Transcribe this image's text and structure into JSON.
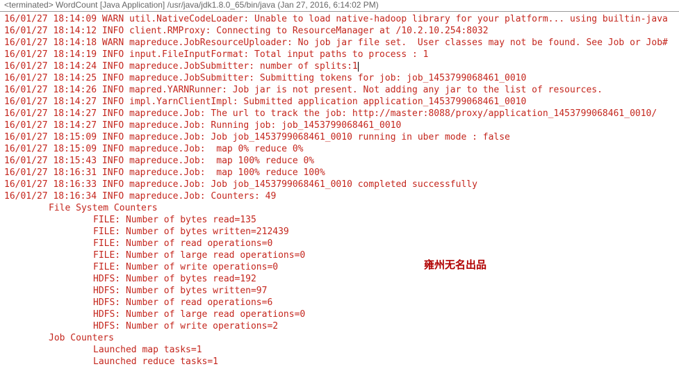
{
  "header": {
    "text": "<terminated> WordCount [Java Application] /usr/java/jdk1.8.0_65/bin/java (Jan 27, 2016, 6:14:02 PM)"
  },
  "watermark": "雍州无名出品",
  "log_lines": [
    {
      "indent": 0,
      "text": "16/01/27 18:14:09 WARN util.NativeCodeLoader: Unable to load native-hadoop library for your platform... using builtin-java",
      "caret": false
    },
    {
      "indent": 0,
      "text": "16/01/27 18:14:12 INFO client.RMProxy: Connecting to ResourceManager at /10.2.10.254:8032",
      "caret": false
    },
    {
      "indent": 0,
      "text": "16/01/27 18:14:18 WARN mapreduce.JobResourceUploader: No job jar file set.  User classes may not be found. See Job or Job#",
      "caret": false
    },
    {
      "indent": 0,
      "text": "16/01/27 18:14:19 INFO input.FileInputFormat: Total input paths to process : 1",
      "caret": false
    },
    {
      "indent": 0,
      "text": "16/01/27 18:14:24 INFO mapreduce.JobSubmitter: number of splits:1",
      "caret": true
    },
    {
      "indent": 0,
      "text": "16/01/27 18:14:25 INFO mapreduce.JobSubmitter: Submitting tokens for job: job_1453799068461_0010",
      "caret": false
    },
    {
      "indent": 0,
      "text": "16/01/27 18:14:26 INFO mapred.YARNRunner: Job jar is not present. Not adding any jar to the list of resources.",
      "caret": false
    },
    {
      "indent": 0,
      "text": "16/01/27 18:14:27 INFO impl.YarnClientImpl: Submitted application application_1453799068461_0010",
      "caret": false
    },
    {
      "indent": 0,
      "text": "16/01/27 18:14:27 INFO mapreduce.Job: The url to track the job: http://master:8088/proxy/application_1453799068461_0010/",
      "caret": false
    },
    {
      "indent": 0,
      "text": "16/01/27 18:14:27 INFO mapreduce.Job: Running job: job_1453799068461_0010",
      "caret": false
    },
    {
      "indent": 0,
      "text": "16/01/27 18:15:09 INFO mapreduce.Job: Job job_1453799068461_0010 running in uber mode : false",
      "caret": false
    },
    {
      "indent": 0,
      "text": "16/01/27 18:15:09 INFO mapreduce.Job:  map 0% reduce 0%",
      "caret": false
    },
    {
      "indent": 0,
      "text": "16/01/27 18:15:43 INFO mapreduce.Job:  map 100% reduce 0%",
      "caret": false
    },
    {
      "indent": 0,
      "text": "16/01/27 18:16:31 INFO mapreduce.Job:  map 100% reduce 100%",
      "caret": false
    },
    {
      "indent": 0,
      "text": "16/01/27 18:16:33 INFO mapreduce.Job: Job job_1453799068461_0010 completed successfully",
      "caret": false
    },
    {
      "indent": 0,
      "text": "16/01/27 18:16:34 INFO mapreduce.Job: Counters: 49",
      "caret": false
    },
    {
      "indent": 1,
      "text": "File System Counters",
      "caret": false
    },
    {
      "indent": 2,
      "text": "FILE: Number of bytes read=135",
      "caret": false
    },
    {
      "indent": 2,
      "text": "FILE: Number of bytes written=212439",
      "caret": false
    },
    {
      "indent": 2,
      "text": "FILE: Number of read operations=0",
      "caret": false
    },
    {
      "indent": 2,
      "text": "FILE: Number of large read operations=0",
      "caret": false
    },
    {
      "indent": 2,
      "text": "FILE: Number of write operations=0",
      "caret": false
    },
    {
      "indent": 2,
      "text": "HDFS: Number of bytes read=192",
      "caret": false
    },
    {
      "indent": 2,
      "text": "HDFS: Number of bytes written=97",
      "caret": false
    },
    {
      "indent": 2,
      "text": "HDFS: Number of read operations=6",
      "caret": false
    },
    {
      "indent": 2,
      "text": "HDFS: Number of large read operations=0",
      "caret": false
    },
    {
      "indent": 2,
      "text": "HDFS: Number of write operations=2",
      "caret": false
    },
    {
      "indent": 1,
      "text": "Job Counters ",
      "caret": false
    },
    {
      "indent": 2,
      "text": "Launched map tasks=1",
      "caret": false
    },
    {
      "indent": 2,
      "text": "Launched reduce tasks=1",
      "caret": false
    }
  ]
}
